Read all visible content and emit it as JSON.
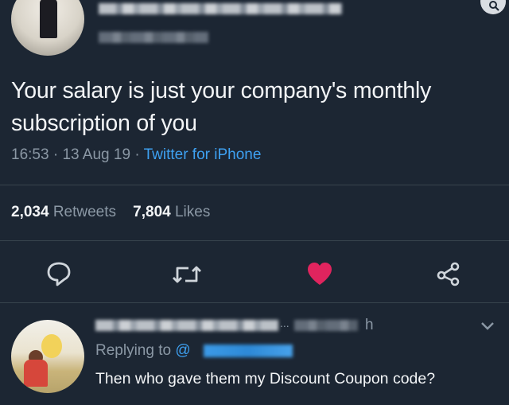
{
  "tweet": {
    "text": "Your salary is just your company's monthly subscription of you",
    "time": "16:53",
    "sep1": "·",
    "date": "13 Aug 19",
    "sep2": "·",
    "source": "Twitter for iPhone",
    "retweets_count": "2,034",
    "retweets_label": "Retweets",
    "likes_count": "7,804",
    "likes_label": "Likes"
  },
  "icons": {
    "reply": "speech-bubble-icon",
    "retweet": "retweet-icon",
    "like": "heart-icon",
    "share": "share-icon",
    "search": "search-icon",
    "more": "chevron-down-icon"
  },
  "colors": {
    "background": "#1c2633",
    "link": "#3ea1f2",
    "like": "#e0245e",
    "muted": "#8b98a5"
  },
  "reply": {
    "handle_tail": "h",
    "dots": "...",
    "replying_to_label": "Replying to",
    "at": "@",
    "text": "Then who gave them my Discount Coupon code?"
  }
}
